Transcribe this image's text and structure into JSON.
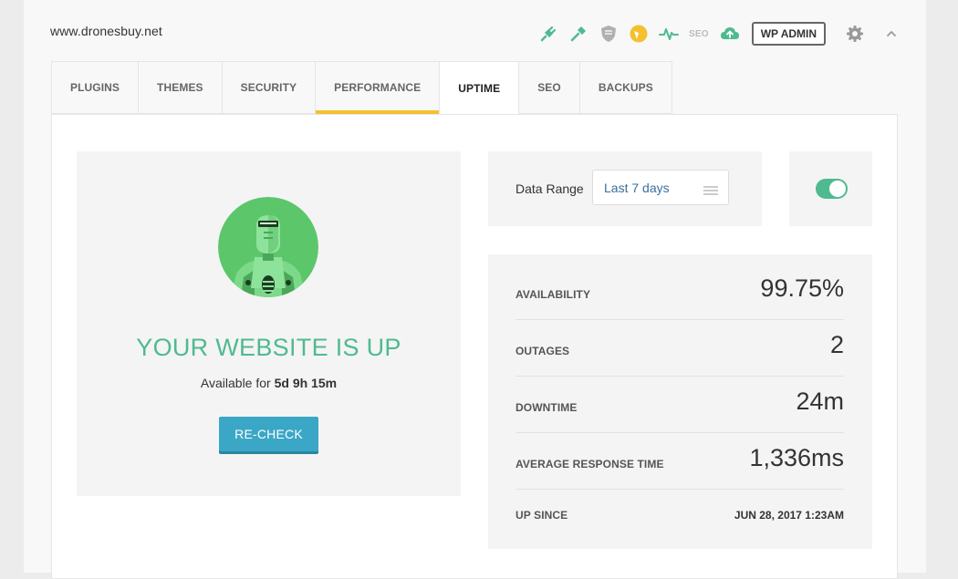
{
  "site": {
    "url": "www.dronesbuy.net"
  },
  "toolbar": {
    "icons": [
      "plugin-icon",
      "hammer-icon",
      "shield-icon",
      "performance-icon",
      "uptime-icon",
      "seo-icon",
      "backup-cloud-icon"
    ],
    "seo_label": "SEO",
    "wp_admin_label": "WP ADMIN"
  },
  "tabs": [
    {
      "label": "PLUGINS"
    },
    {
      "label": "THEMES"
    },
    {
      "label": "SECURITY"
    },
    {
      "label": "PERFORMANCE"
    },
    {
      "label": "UPTIME"
    },
    {
      "label": "SEO"
    },
    {
      "label": "BACKUPS"
    }
  ],
  "uptime": {
    "status_title": "YOUR WEBSITE IS UP",
    "available_prefix": "Available for",
    "available_value": "5d 9h 15m",
    "recheck_label": "RE-CHECK",
    "data_range_label": "Data Range",
    "data_range_value": "Last 7 days",
    "toggle_on": true,
    "stats": [
      {
        "label": "AVAILABILITY",
        "value": "99.75%"
      },
      {
        "label": "OUTAGES",
        "value": "2"
      },
      {
        "label": "DOWNTIME",
        "value": "24m"
      },
      {
        "label": "AVERAGE RESPONSE TIME",
        "value": "1,336ms"
      },
      {
        "label": "UP SINCE",
        "value": "JUN 28, 2017 1:23AM"
      }
    ]
  },
  "colors": {
    "accent_green": "#4fba8f",
    "tab_highlight": "#f4c02e",
    "button_blue": "#3ba7c6",
    "shield_gray": "#b0b0b0",
    "performance_yellow": "#f4c02e"
  }
}
